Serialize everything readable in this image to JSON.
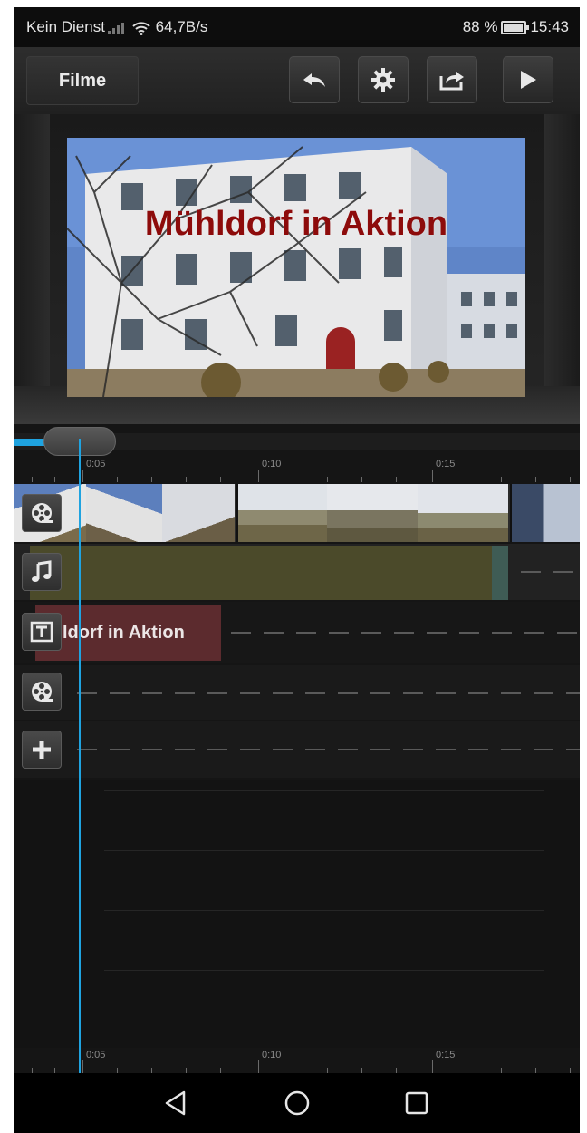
{
  "status_bar": {
    "carrier": "Kein Dienst",
    "speed": "64,7B/s",
    "battery": "88 %",
    "time": "15:43"
  },
  "toolbar": {
    "films_label": "Filme",
    "icons": [
      "undo-icon",
      "settings-gear-icon",
      "share-export-icon",
      "play-icon"
    ]
  },
  "preview": {
    "title_overlay": "Mühldorf in Aktion"
  },
  "timeline": {
    "ruler_labels": [
      "0:05",
      "0:10",
      "0:15"
    ],
    "text_clip": "ldorf in Aktion",
    "track_icons": [
      "film-reel-icon",
      "music-note-icon",
      "text-icon",
      "film-reel-icon",
      "add-plus-icon"
    ]
  },
  "navbar": {
    "icons": [
      "back-triangle-icon",
      "home-circle-icon",
      "recents-square-icon"
    ]
  },
  "colors": {
    "accent": "#1fa3e0",
    "title_red": "#8d0b0b",
    "audio_clip": "#4b4a2a",
    "text_clip": "#5c2b2e"
  }
}
